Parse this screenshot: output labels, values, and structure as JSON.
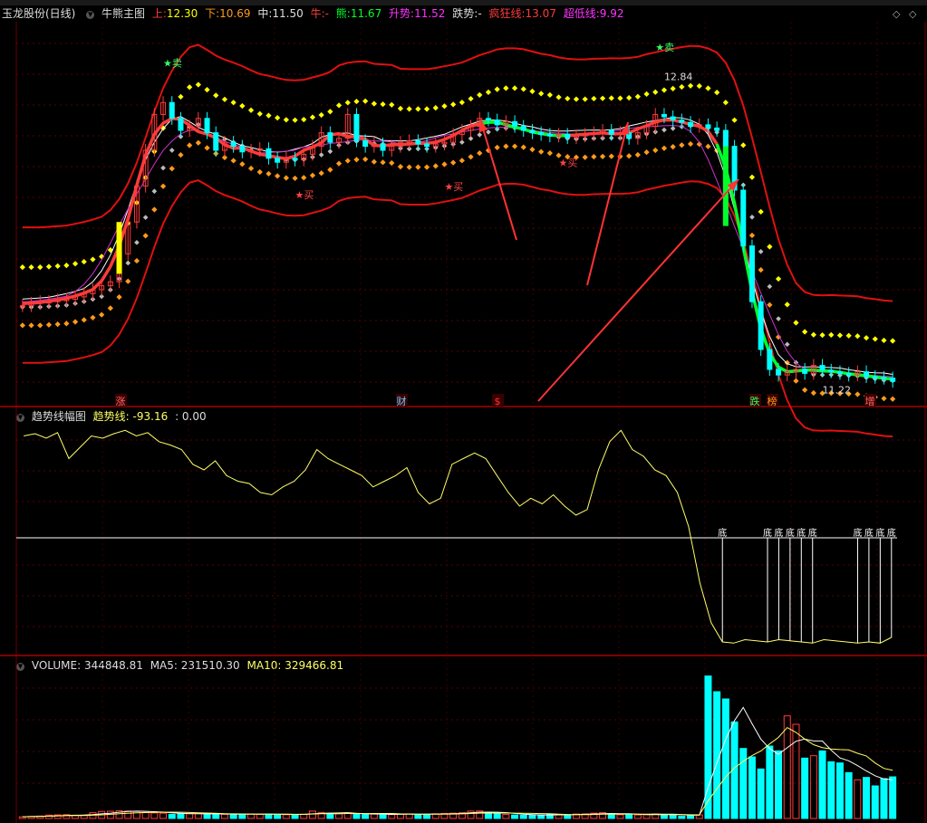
{
  "header": {
    "stock_name": "玉龙股份(日线)",
    "main_indicator": "牛熊主图",
    "up_label": "上:",
    "up_value": "12.30",
    "down_label": "下:",
    "down_value": "10.69",
    "mid_label": "中:",
    "mid_value": "11.50",
    "bull_label": "牛:",
    "bull_value": "-",
    "bear_label": "熊:",
    "bear_value": "11.67",
    "rise_label": "升势:",
    "rise_value": "11.52",
    "fall_label": "跌势:",
    "fall_value": "-",
    "crazy_label": "疯狂线:",
    "crazy_value": "13.07",
    "superlow_label": "超低线:",
    "superlow_value": "9.92"
  },
  "mid_panel": {
    "title": "趋势线幅图",
    "value_label": "趋势线:",
    "value": "-93.16",
    "value2": ": 0.00",
    "marker": "底"
  },
  "volume_panel": {
    "label": "VOLUME:",
    "value": "344848.81",
    "ma5_label": "MA5:",
    "ma5_value": "231510.30",
    "ma10_label": "MA10:",
    "ma10_value": "329466.81"
  },
  "annotations": {
    "sell": "★卖",
    "buy": "★买",
    "sell_price_label": "12.84",
    "buy_price_label": "11.22",
    "bottom_tags": [
      "涨",
      "财",
      "$",
      "跌",
      "榜",
      "增"
    ]
  },
  "colors": {
    "bg": "#000000",
    "up": "#ff3b3b",
    "down": "#00ffff",
    "yellow": "#ffff00",
    "orange": "#ff9a1a",
    "green": "#00ff2a",
    "band": "#e01010",
    "magenta": "#cc33cc",
    "white_line": "#ffffff",
    "grid": "#5a0000"
  },
  "chart_data": [
    {
      "type": "candlestick",
      "title": "牛熊主图",
      "ylim": [
        9.5,
        14.0
      ],
      "close": [
        10.55,
        10.58,
        10.6,
        10.6,
        10.62,
        10.63,
        10.66,
        10.7,
        10.75,
        10.8,
        10.85,
        11.2,
        11.6,
        12.05,
        12.5,
        12.95,
        13.1,
        12.9,
        12.75,
        12.8,
        12.9,
        12.72,
        12.5,
        12.6,
        12.55,
        12.48,
        12.5,
        12.52,
        12.4,
        12.35,
        12.4,
        12.38,
        12.45,
        12.55,
        12.72,
        12.6,
        12.65,
        12.95,
        12.62,
        12.55,
        12.58,
        12.5,
        12.55,
        12.6,
        12.62,
        12.58,
        12.55,
        12.58,
        12.6,
        12.7,
        12.75,
        12.8,
        12.9,
        12.88,
        12.82,
        12.86,
        12.8,
        12.75,
        12.72,
        12.7,
        12.68,
        12.7,
        12.66,
        12.68,
        12.7,
        12.72,
        12.75,
        12.7,
        12.72,
        12.65,
        12.72,
        12.8,
        12.95,
        12.92,
        12.88,
        12.85,
        12.8,
        12.82,
        12.78,
        12.75,
        12.55,
        12.0,
        11.3,
        10.6,
        10.0,
        9.75,
        9.68,
        9.72,
        9.75,
        9.7,
        9.8,
        9.74,
        9.72,
        9.7,
        9.68,
        9.72,
        9.66,
        9.65,
        9.64,
        9.6
      ]
    },
    {
      "type": "line",
      "title": "趋势线幅图",
      "ylim": [
        -100,
        100
      ],
      "values": [
        90,
        92,
        88,
        93,
        70,
        80,
        90,
        88,
        92,
        95,
        90,
        93,
        85,
        82,
        78,
        65,
        60,
        68,
        55,
        50,
        48,
        40,
        38,
        45,
        50,
        60,
        78,
        70,
        65,
        60,
        55,
        45,
        50,
        55,
        62,
        40,
        30,
        35,
        65,
        70,
        75,
        70,
        55,
        40,
        28,
        35,
        30,
        38,
        28,
        20,
        25,
        60,
        85,
        95,
        78,
        72,
        60,
        55,
        40,
        10,
        -40,
        -75,
        -92,
        -93,
        -90,
        -91,
        -92,
        -90,
        -91,
        -92,
        -93,
        -90,
        -91,
        -92,
        -93,
        -92,
        -93,
        -88
      ]
    },
    {
      "type": "bar",
      "title": "VOLUME",
      "ylim": [
        0,
        1200000
      ],
      "values": [
        14000,
        17000,
        20000,
        28000,
        30000,
        32000,
        25000,
        28000,
        48000,
        58000,
        60000,
        64000,
        62000,
        58000,
        51000,
        46000,
        44000,
        34000,
        38000,
        39000,
        40000,
        39000,
        36000,
        34000,
        32000,
        37000,
        37000,
        35000,
        36000,
        34000,
        31000,
        32000,
        35000,
        61000,
        50000,
        45000,
        39000,
        46000,
        34000,
        33000,
        36000,
        34000,
        32000,
        37000,
        38000,
        34000,
        35000,
        39000,
        42000,
        44000,
        48000,
        61000,
        62000,
        48000,
        38000,
        34000,
        29000,
        27000,
        30000,
        28000,
        34000,
        32000,
        31000,
        37000,
        38000,
        44000,
        48000,
        38000,
        31000,
        33000,
        29000,
        32000,
        37000,
        32000,
        33000,
        18000,
        22000,
        30000,
        1180000,
        1050000,
        990000,
        800000,
        580000,
        510000,
        410000,
        600000,
        560000,
        850000,
        780000,
        500000,
        520000,
        560000,
        470000,
        460000,
        380000,
        320000,
        340000,
        270000,
        330000,
        344848.81
      ]
    }
  ]
}
